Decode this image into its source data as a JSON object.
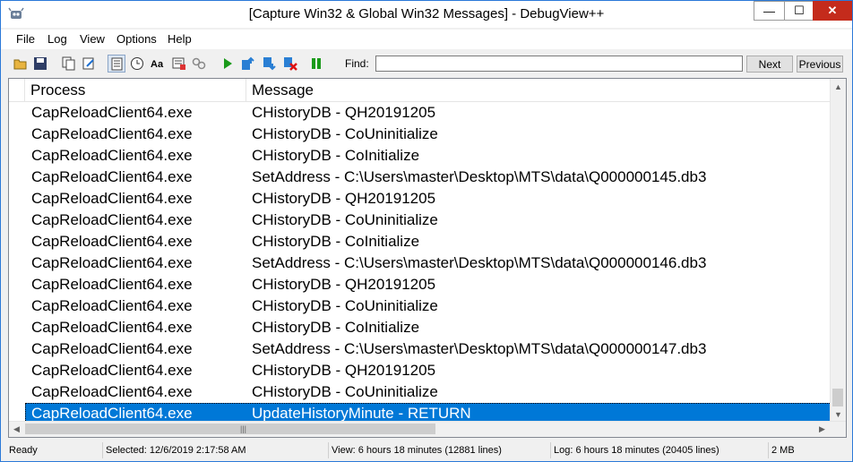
{
  "window": {
    "title": "[Capture Win32 & Global Win32 Messages] - DebugView++",
    "controls": {
      "minimize": "—",
      "maximize": "☐",
      "close": "✕"
    }
  },
  "menu": [
    "File",
    "Log",
    "View",
    "Options",
    "Help"
  ],
  "toolbar": {
    "icons": [
      "open-icon",
      "save-icon",
      "copy-icon",
      "edit-icon",
      "autoscroll-icon",
      "clock-icon",
      "font-icon",
      "filter-icon",
      "link-icon",
      "play-icon",
      "bookmark-up-icon",
      "bookmark-down-icon",
      "clear-bookmark-icon",
      "pause-icon"
    ],
    "find_label": "Find:",
    "find_value": "",
    "next_label": "Next",
    "previous_label": "Previous"
  },
  "list": {
    "columns": [
      "Process",
      "Message"
    ],
    "rows": [
      {
        "process": "CapReloadClient64.exe",
        "message": "CHistoryDB - QH20191205"
      },
      {
        "process": "CapReloadClient64.exe",
        "message": "CHistoryDB - CoUninitialize"
      },
      {
        "process": "CapReloadClient64.exe",
        "message": "CHistoryDB - CoInitialize"
      },
      {
        "process": "CapReloadClient64.exe",
        "message": "SetAddress - C:\\Users\\master\\Desktop\\MTS\\data\\Q000000145.db3"
      },
      {
        "process": "CapReloadClient64.exe",
        "message": "CHistoryDB - QH20191205"
      },
      {
        "process": "CapReloadClient64.exe",
        "message": "CHistoryDB - CoUninitialize"
      },
      {
        "process": "CapReloadClient64.exe",
        "message": "CHistoryDB - CoInitialize"
      },
      {
        "process": "CapReloadClient64.exe",
        "message": "SetAddress - C:\\Users\\master\\Desktop\\MTS\\data\\Q000000146.db3"
      },
      {
        "process": "CapReloadClient64.exe",
        "message": "CHistoryDB - QH20191205"
      },
      {
        "process": "CapReloadClient64.exe",
        "message": "CHistoryDB - CoUninitialize"
      },
      {
        "process": "CapReloadClient64.exe",
        "message": "CHistoryDB - CoInitialize"
      },
      {
        "process": "CapReloadClient64.exe",
        "message": "SetAddress - C:\\Users\\master\\Desktop\\MTS\\data\\Q000000147.db3"
      },
      {
        "process": "CapReloadClient64.exe",
        "message": "CHistoryDB - QH20191205"
      },
      {
        "process": "CapReloadClient64.exe",
        "message": "CHistoryDB - CoUninitialize"
      },
      {
        "process": "CapReloadClient64.exe",
        "message": "UpdateHistoryMinute - RETURN",
        "selected": true
      }
    ]
  },
  "status": {
    "state": "Ready",
    "selected": "Selected: 12/6/2019 2:17:58 AM",
    "view": "View: 6 hours 18 minutes (12881 lines)",
    "log": "Log: 6 hours 18 minutes (20405 lines)",
    "memory": "2 MB"
  },
  "colors": {
    "selection": "#0078d7",
    "close_button": "#c42b1c",
    "window_border": "#2b79d8"
  }
}
